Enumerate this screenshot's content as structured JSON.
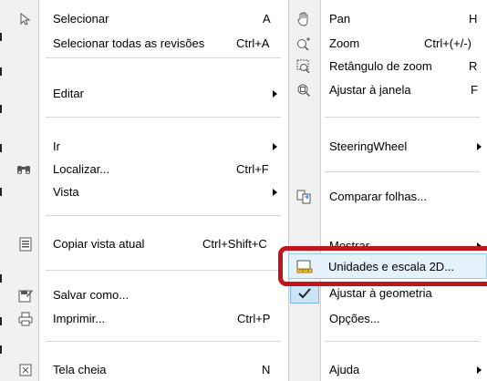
{
  "left_menu": {
    "select": {
      "label": "Selecionar",
      "shortcut": "A",
      "icon": "pointer-arrow-icon"
    },
    "select_all": {
      "label": "Selecionar todas as revisões",
      "shortcut": "Ctrl+A"
    },
    "edit": {
      "label": "Editar"
    },
    "goto": {
      "label": "Ir"
    },
    "find": {
      "label": "Localizar...",
      "shortcut": "Ctrl+F",
      "icon": "binoculars-icon"
    },
    "view": {
      "label": "Vista"
    },
    "copy_view": {
      "label": "Copiar vista atual",
      "shortcut": "Ctrl+Shift+C",
      "icon": "copy-view-icon"
    },
    "save_as": {
      "label": "Salvar como...",
      "icon": "save-as-icon"
    },
    "print": {
      "label": "Imprimir...",
      "shortcut": "Ctrl+P",
      "icon": "printer-icon"
    },
    "fullscreen": {
      "label": "Tela cheia",
      "shortcut": "N",
      "icon": "fullscreen-icon"
    }
  },
  "right_menu": {
    "pan": {
      "label": "Pan",
      "shortcut": "H",
      "icon": "hand-pan-icon"
    },
    "zoom": {
      "label": "Zoom",
      "shortcut": "Ctrl+(+/-)",
      "icon": "zoom-plus-minus-icon"
    },
    "zoom_rect": {
      "label": "Retângulo de zoom",
      "shortcut": "R",
      "icon": "zoom-rectangle-icon"
    },
    "zoom_fit": {
      "label": "Ajustar à janela",
      "shortcut": "F",
      "icon": "zoom-fit-icon"
    },
    "steering": {
      "label": "SteeringWheel"
    },
    "compare": {
      "label": "Comparar folhas...",
      "icon": "compare-sheets-icon"
    },
    "show": {
      "label": "Mostrar"
    },
    "units": {
      "label": "Unidades e escala 2D...",
      "icon": "ruler-scale-icon"
    },
    "fit_geometry": {
      "label": "Ajustar à geometria",
      "checked": true
    },
    "options": {
      "label": "Opções..."
    },
    "help": {
      "label": "Ajuda"
    }
  },
  "colors": {
    "highlight_fill": "#e5f1fb",
    "highlight_border": "#99c9ef",
    "callout": "#c0151b",
    "check_fill": "#cce4f7"
  }
}
